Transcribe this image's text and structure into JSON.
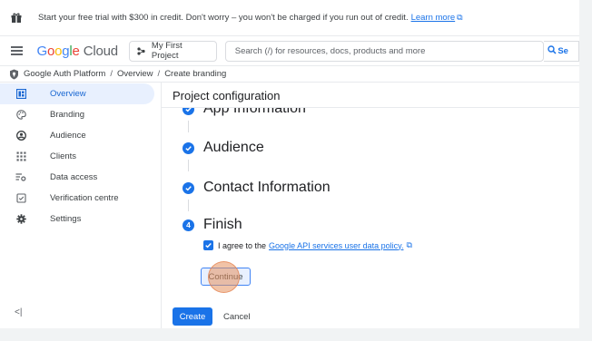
{
  "promo": {
    "text": "Start your free trial with $300 in credit. Don't worry – you won't be charged if you run out of credit.",
    "link": "Learn more"
  },
  "topbar": {
    "logo_letters": [
      "G",
      "o",
      "o",
      "g",
      "l",
      "e"
    ],
    "logo_product": "Cloud",
    "project": "My First Project",
    "search_placeholder": "Search (/) for resources, docs, products and more",
    "search_button": "Se"
  },
  "breadcrumb": {
    "items": [
      "Google Auth Platform",
      "Overview",
      "Create branding"
    ]
  },
  "sidebar": {
    "items": [
      {
        "label": "Overview",
        "icon": "dashboard-icon",
        "active": true
      },
      {
        "label": "Branding",
        "icon": "palette-icon",
        "active": false
      },
      {
        "label": "Audience",
        "icon": "person-circle-icon",
        "active": false
      },
      {
        "label": "Clients",
        "icon": "grid-icon",
        "active": false
      },
      {
        "label": "Data access",
        "icon": "data-access-icon",
        "active": false
      },
      {
        "label": "Verification centre",
        "icon": "verified-icon",
        "active": false
      },
      {
        "label": "Settings",
        "icon": "gear-icon",
        "active": false
      }
    ],
    "collapse": "<|"
  },
  "main": {
    "title": "Project configuration",
    "steps": [
      {
        "label": "App Information",
        "state": "done"
      },
      {
        "label": "Audience",
        "state": "done"
      },
      {
        "label": "Contact Information",
        "state": "done"
      },
      {
        "label": "Finish",
        "state": "current",
        "number": "4"
      }
    ],
    "agree_text": "I agree to the",
    "agree_link": "Google API services user data policy.",
    "continue": "Continue",
    "create": "Create",
    "cancel": "Cancel"
  },
  "colors": {
    "accent": "#1a73e8",
    "active_bg": "#e8f0fe"
  }
}
